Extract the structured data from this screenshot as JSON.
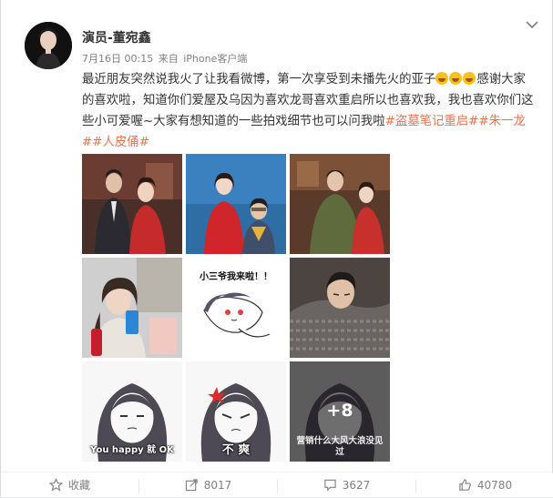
{
  "post": {
    "username": "演员-董宛鑫",
    "date": "7月16日 00:15",
    "source_prefix": "来自",
    "source": "iPhone客户端",
    "text_part1": "最近朋友突然说我火了让我看微博，第一次享受到未播先火的亚子",
    "text_part2": "感谢大家的喜欢啦，知道你们爱屋及乌因为喜欢龙哥喜欢重启所以也喜欢我，我也喜欢你们这些小可爱喔~大家有想知道的一些拍戏细节也可以问我啦",
    "tags": [
      "#盗墓笔记重启#",
      "#朱一龙#",
      "#人皮俑#"
    ]
  },
  "images": [
    {
      "name": "photo-couple-red-room"
    },
    {
      "name": "photo-blue-wall-selfie"
    },
    {
      "name": "photo-green-jacket-couple"
    },
    {
      "name": "photo-makeup-drink"
    },
    {
      "name": "sticker-xiaosanye",
      "text": "小三爷我来啦！！"
    },
    {
      "name": "photo-sleeping-man"
    },
    {
      "name": "sticker-you-happy",
      "text": "You happy 就 OK"
    },
    {
      "name": "sticker-bu-shuang",
      "text": "不 爽"
    },
    {
      "name": "sticker-more",
      "text": "营销什么大风大浪没见过",
      "more": "+8"
    }
  ],
  "actions": {
    "favorite": "收藏",
    "share": "8017",
    "comment": "3627",
    "like": "40780"
  },
  "colors": {
    "accent": "#eb7350",
    "text": "#333333",
    "meta": "#808080"
  },
  "icons": [
    "chevron-down-icon",
    "star-icon",
    "share-icon",
    "comment-icon",
    "thumbs-up-icon"
  ]
}
